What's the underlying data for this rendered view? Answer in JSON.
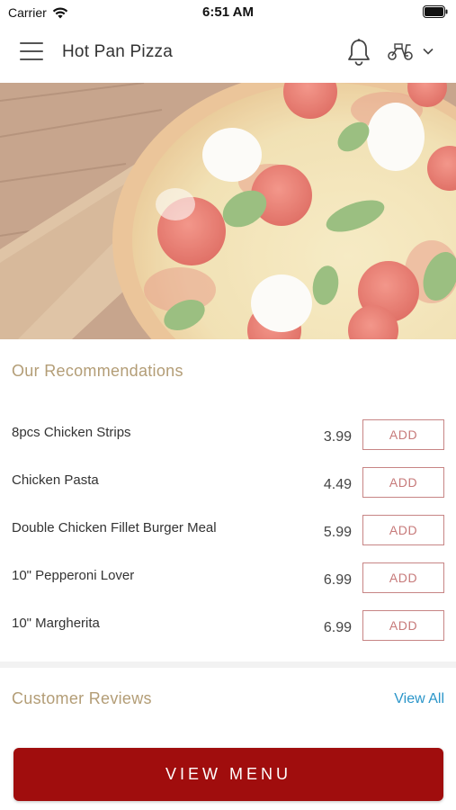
{
  "status_bar": {
    "carrier": "Carrier",
    "time": "6:51 AM"
  },
  "header": {
    "title": "Hot Pan Pizza",
    "menu_icon": "hamburger-menu-icon",
    "notification_icon": "bell-icon",
    "order_mode_icon": "scooter-icon",
    "dropdown_icon": "chevron-down-icon"
  },
  "recommendations": {
    "title": "Our Recommendations",
    "items": [
      {
        "name": "8pcs Chicken Strips",
        "price": "3.99",
        "button": "ADD"
      },
      {
        "name": "Chicken Pasta",
        "price": "4.49",
        "button": "ADD"
      },
      {
        "name": "Double Chicken Fillet Burger Meal",
        "price": "5.99",
        "button": "ADD"
      },
      {
        "name": "10\" Pepperoni Lover",
        "price": "6.99",
        "button": "ADD"
      },
      {
        "name": "10\" Margherita",
        "price": "6.99",
        "button": "ADD"
      }
    ]
  },
  "reviews": {
    "title": "Customer Reviews",
    "view_all": "View All"
  },
  "bottom": {
    "view_menu": "VIEW MENU"
  },
  "colors": {
    "brand_red": "#a00d0d",
    "section_title": "#b39d76",
    "add_border": "#c78585",
    "link_blue": "#2a95c9"
  }
}
